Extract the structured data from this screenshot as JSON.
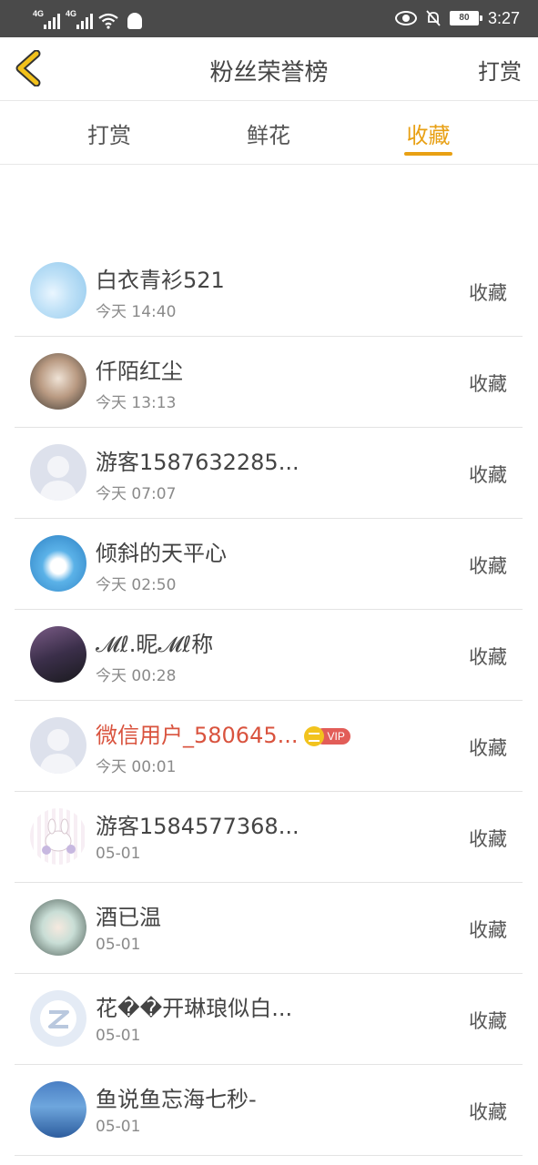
{
  "status_bar": {
    "signal1_label": "4G",
    "signal2_label": "4G",
    "battery": "80",
    "time": "3:27"
  },
  "header": {
    "title": "粉丝荣誉榜",
    "right_action": "打赏"
  },
  "tabs": [
    {
      "label": "打赏",
      "active": false
    },
    {
      "label": "鲜花",
      "active": false
    },
    {
      "label": "收藏",
      "active": true
    }
  ],
  "colors": {
    "accent": "#e8a014",
    "vip_name": "#d9533e",
    "status_bar": "#4a4a4a"
  },
  "fans": [
    {
      "name": "白衣青衫521",
      "time": "今天 14:40",
      "action": "收藏",
      "avatar": "sky-photo"
    },
    {
      "name": "仟陌红尘",
      "time": "今天 13:13",
      "action": "收藏",
      "avatar": "girl-photo"
    },
    {
      "name": "游客1587632285...",
      "time": "今天 07:07",
      "action": "收藏",
      "avatar": "default-avatar"
    },
    {
      "name": "倾斜的天平心",
      "time": "今天 02:50",
      "action": "收藏",
      "avatar": "cloud-photo"
    },
    {
      "name": "𝓜ℓ.昵𝓜ℓ称",
      "time": "今天 00:28",
      "action": "收藏",
      "avatar": "boy-photo"
    },
    {
      "name": "微信用户_580645...",
      "time": "今天 00:01",
      "action": "收藏",
      "avatar": "default-avatar",
      "vip": "VIP"
    },
    {
      "name": "游客1584577368...",
      "time": "05-01",
      "action": "收藏",
      "avatar": "cartoon-avatar"
    },
    {
      "name": "酒已温",
      "time": "05-01",
      "action": "收藏",
      "avatar": "anime-avatar"
    },
    {
      "name": "花��开琳琅似白...",
      "time": "05-01",
      "action": "收藏",
      "avatar": "qq-avatar"
    },
    {
      "name": "鱼说鱼忘海七秒-",
      "time": "05-01",
      "action": "收藏",
      "avatar": "beach-photo"
    }
  ]
}
